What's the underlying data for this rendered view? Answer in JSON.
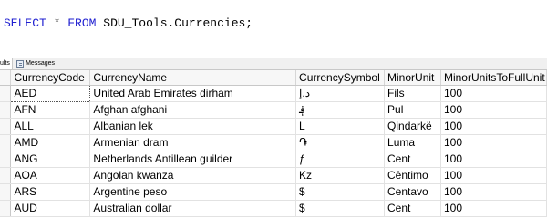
{
  "query": {
    "select": "SELECT",
    "star": "*",
    "from": "FROM",
    "object": "SDU_Tools.Currencies;"
  },
  "tabs": {
    "results": "ults",
    "messages": "Messages"
  },
  "columns": [
    "CurrencyCode",
    "CurrencyName",
    "CurrencySymbol",
    "MinorUnit",
    "MinorUnitsToFullUnit"
  ],
  "rows": [
    [
      "AED",
      "United Arab Emirates dirham",
      "د.إ",
      "Fils",
      "100"
    ],
    [
      "AFN",
      "Afghan afghani",
      "؋",
      "Pul",
      "100"
    ],
    [
      "ALL",
      "Albanian lek",
      "L",
      "Qindarkë",
      "100"
    ],
    [
      "AMD",
      "Armenian dram",
      "֏",
      "Luma",
      "100"
    ],
    [
      "ANG",
      "Netherlands Antillean guilder",
      "ƒ",
      "Cent",
      "100"
    ],
    [
      "AOA",
      "Angolan kwanza",
      "Kz",
      "Cêntimo",
      "100"
    ],
    [
      "ARS",
      "Argentine peso",
      "$",
      "Centavo",
      "100"
    ],
    [
      "AUD",
      "Australian dollar",
      "$",
      "Cent",
      "100"
    ]
  ]
}
